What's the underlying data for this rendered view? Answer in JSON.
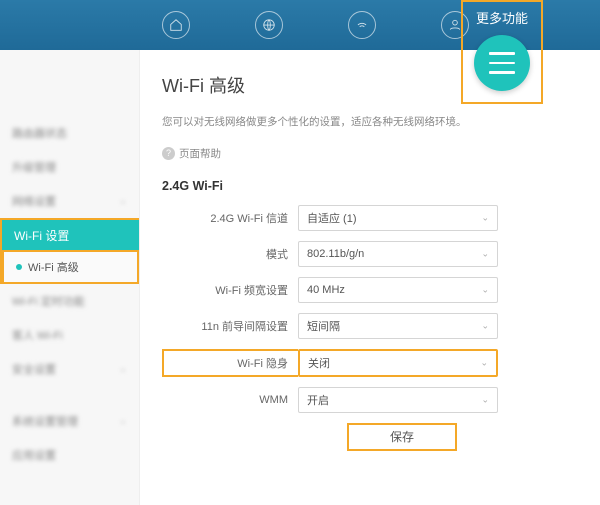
{
  "topbar": {
    "more_label": "更多功能"
  },
  "sidebar": {
    "active_label": "Wi-Fi 设置",
    "sub_active": "Wi-Fi 高级"
  },
  "page": {
    "title": "Wi-Fi 高级",
    "desc": "您可以对无线网络做更多个性化的设置，适应各种无线网络环境。",
    "help": "页面帮助"
  },
  "section": {
    "title": "2.4G Wi-Fi"
  },
  "form": {
    "channel": {
      "label": "2.4G Wi-Fi 信道",
      "value": "自适应 (1)"
    },
    "mode": {
      "label": "模式",
      "value": "802.11b/g/n"
    },
    "bw": {
      "label": "Wi-Fi 频宽设置",
      "value": "40 MHz"
    },
    "gi": {
      "label": "11n 前导间隔设置",
      "value": "短间隔"
    },
    "hide": {
      "label": "Wi-Fi 隐身",
      "value": "关闭"
    },
    "wmm": {
      "label": "WMM",
      "value": "开启"
    },
    "save": "保存"
  }
}
